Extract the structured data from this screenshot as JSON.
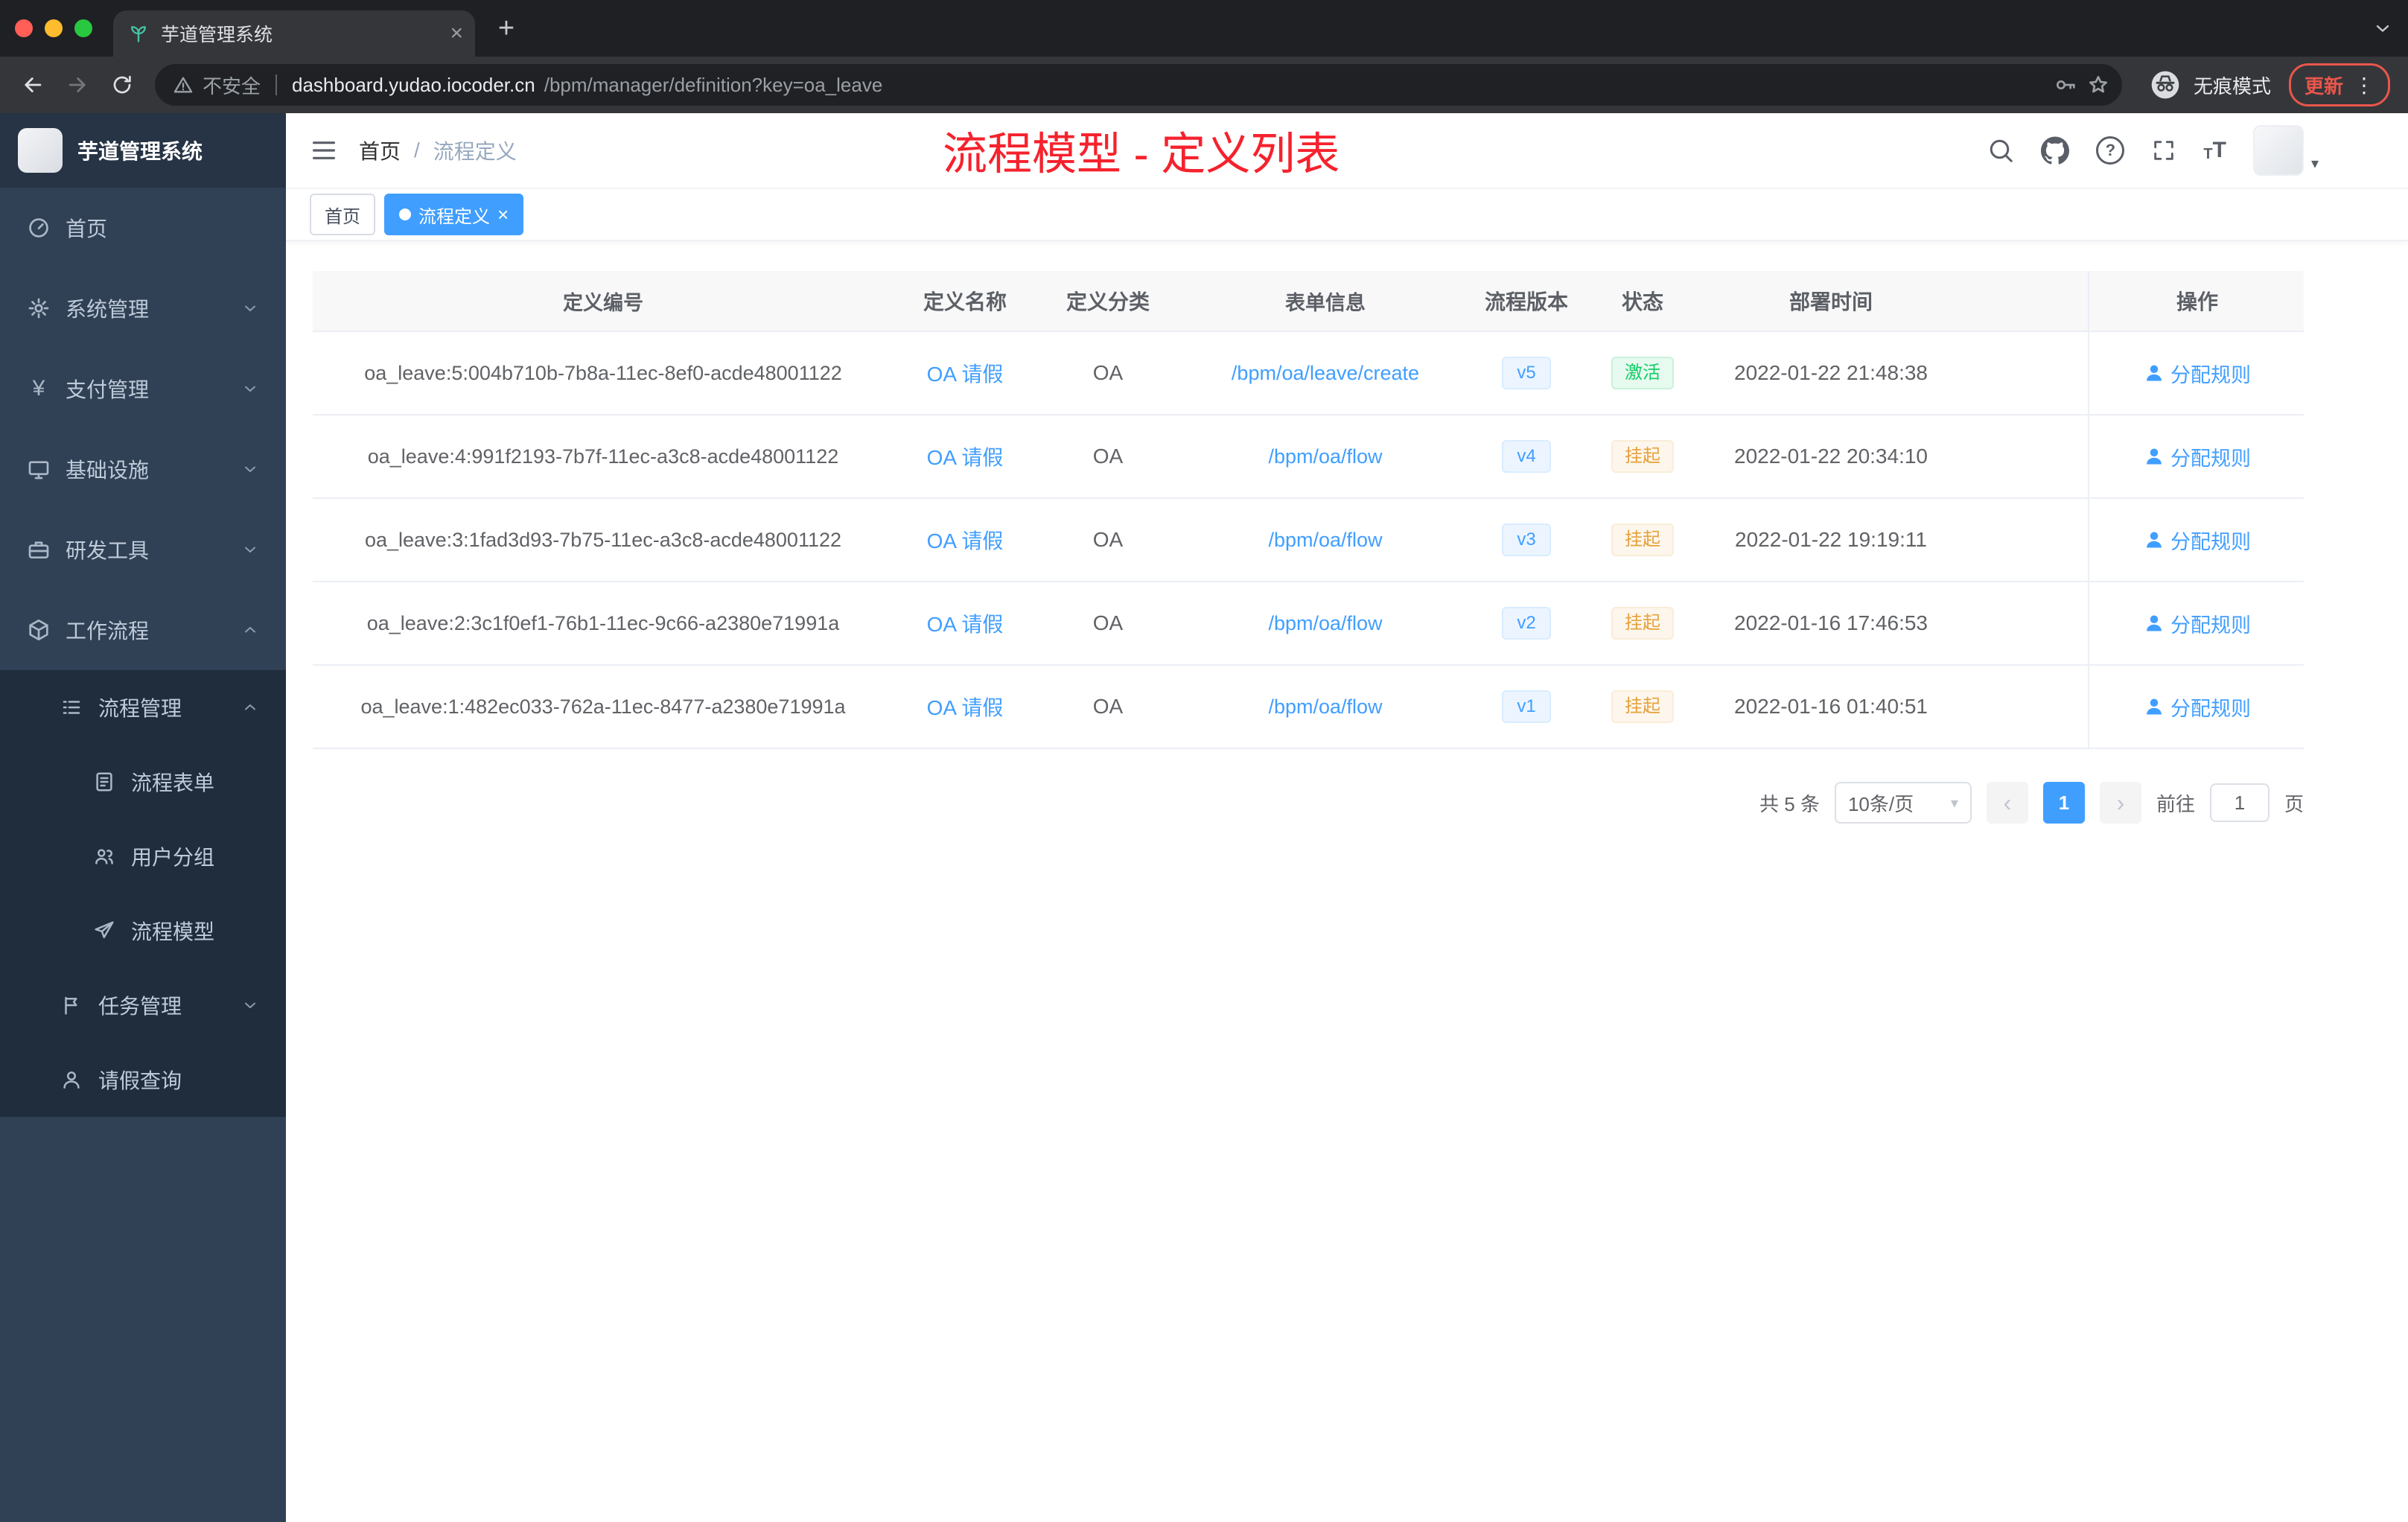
{
  "browser": {
    "tab_title": "芋道管理系统",
    "security_label": "不安全",
    "url_host": "dashboard.yudao.iocoder.cn",
    "url_path": "/bpm/manager/definition?key=oa_leave",
    "incognito_label": "无痕模式",
    "update_label": "更新"
  },
  "glyphs": {
    "close": "×",
    "plus": "+",
    "kebab": "⋮",
    "yen": "¥",
    "question": "?",
    "caret_down": "▾",
    "chev_left": "‹",
    "chev_right": "›",
    "font_small": "T",
    "font_big": "T"
  },
  "icons": {
    "tab_favicon": "sprout-icon",
    "nav_right": [
      "search-icon",
      "github-icon",
      "help-icon",
      "fullscreen-icon",
      "font-size-icon"
    ],
    "omnibox": [
      "warning-triangle-icon",
      "key-icon",
      "star-icon"
    ],
    "incognito": "incognito-icon"
  },
  "sidebar": {
    "logo_title": "芋道管理系统",
    "items": [
      {
        "label": "首页"
      },
      {
        "label": "系统管理"
      },
      {
        "label": "支付管理"
      },
      {
        "label": "基础设施"
      },
      {
        "label": "研发工具"
      },
      {
        "label": "工作流程"
      }
    ],
    "workflow_menu": {
      "process_management": "流程管理",
      "process_children": [
        {
          "label": "流程表单"
        },
        {
          "label": "用户分组"
        },
        {
          "label": "流程模型"
        }
      ],
      "task_management": "任务管理",
      "leave_query": "请假查询"
    }
  },
  "navbar": {
    "breadcrumb_1": "首页",
    "breadcrumb_sep": "/",
    "breadcrumb_2": "流程定义",
    "annotation": "流程模型 - 定义列表"
  },
  "tags": {
    "home": "首页",
    "active": "流程定义"
  },
  "table": {
    "columns": [
      "定义编号",
      "定义名称",
      "定义分类",
      "表单信息",
      "流程版本",
      "状态",
      "部署时间",
      "操作"
    ],
    "rows": [
      {
        "id": "oa_leave:5:004b710b-7b8a-11ec-8ef0-acde48001122",
        "name": "OA 请假",
        "category": "OA",
        "form": "/bpm/oa/leave/create",
        "version": "v5",
        "status": "激活",
        "status_type": "active",
        "time": "2022-01-22 21:48:38",
        "action": "分配规则"
      },
      {
        "id": "oa_leave:4:991f2193-7b7f-11ec-a3c8-acde48001122",
        "name": "OA 请假",
        "category": "OA",
        "form": "/bpm/oa/flow",
        "version": "v4",
        "status": "挂起",
        "status_type": "suspended",
        "time": "2022-01-22 20:34:10",
        "action": "分配规则"
      },
      {
        "id": "oa_leave:3:1fad3d93-7b75-11ec-a3c8-acde48001122",
        "name": "OA 请假",
        "category": "OA",
        "form": "/bpm/oa/flow",
        "version": "v3",
        "status": "挂起",
        "status_type": "suspended",
        "time": "2022-01-22 19:19:11",
        "action": "分配规则"
      },
      {
        "id": "oa_leave:2:3c1f0ef1-76b1-11ec-9c66-a2380e71991a",
        "name": "OA 请假",
        "category": "OA",
        "form": "/bpm/oa/flow",
        "version": "v2",
        "status": "挂起",
        "status_type": "suspended",
        "time": "2022-01-16 17:46:53",
        "action": "分配规则"
      },
      {
        "id": "oa_leave:1:482ec033-762a-11ec-8477-a2380e71991a",
        "name": "OA 请假",
        "category": "OA",
        "form": "/bpm/oa/flow",
        "version": "v1",
        "status": "挂起",
        "status_type": "suspended",
        "time": "2022-01-16 01:40:51",
        "action": "分配规则"
      }
    ]
  },
  "pagination": {
    "total": "共 5 条",
    "page_size": "10条/页",
    "page": "1",
    "goto_prefix": "前往",
    "goto_value": "1",
    "goto_suffix": "页"
  },
  "colors": {
    "accent": "#409eff",
    "annotation_red": "#f5222d",
    "status_active": "#13ce66",
    "status_suspended": "#e6a23c",
    "sidebar_bg": "#304156",
    "submenu_bg": "#1f2d3d"
  }
}
